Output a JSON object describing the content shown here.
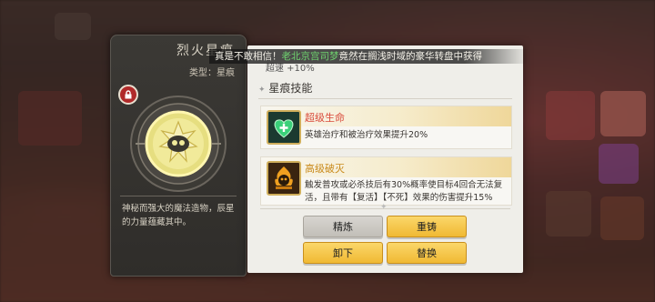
{
  "colors": {
    "skill1_name": "#d94a3a",
    "skill2_name": "#c98a1a",
    "highlight": "#6fd46f",
    "gold_button": "#f0b933",
    "grey_button": "#c2bfb8"
  },
  "card": {
    "title": "烈火星痕",
    "type": "类型：星痕",
    "lock_icon": "lock-icon",
    "description": "神秘而强大的魔法造物，辰星的力量蕴藏其中。"
  },
  "banner": {
    "prefix": "真是不敢相信！",
    "player": "老北京宫司梦",
    "suffix": "竟然在搁浅时域的豪华转盘中获得"
  },
  "panel": {
    "partial_text": "超速 +10%",
    "section_title": "星痕技能",
    "skills": [
      {
        "name": "超级生命",
        "description": "英雄治疗和被治疗效果提升20%",
        "icon": "heart-plus-icon"
      },
      {
        "name": "高级破灭",
        "description": "触发普攻或必杀技后有30%概率使目标4回合无法复活，且带有【复活】【不死】效果的伤害提升15%",
        "icon": "skull-flame-icon"
      }
    ],
    "buttons": {
      "refine": "精炼",
      "recast": "重铸",
      "unequip": "卸下",
      "replace": "替换"
    }
  }
}
